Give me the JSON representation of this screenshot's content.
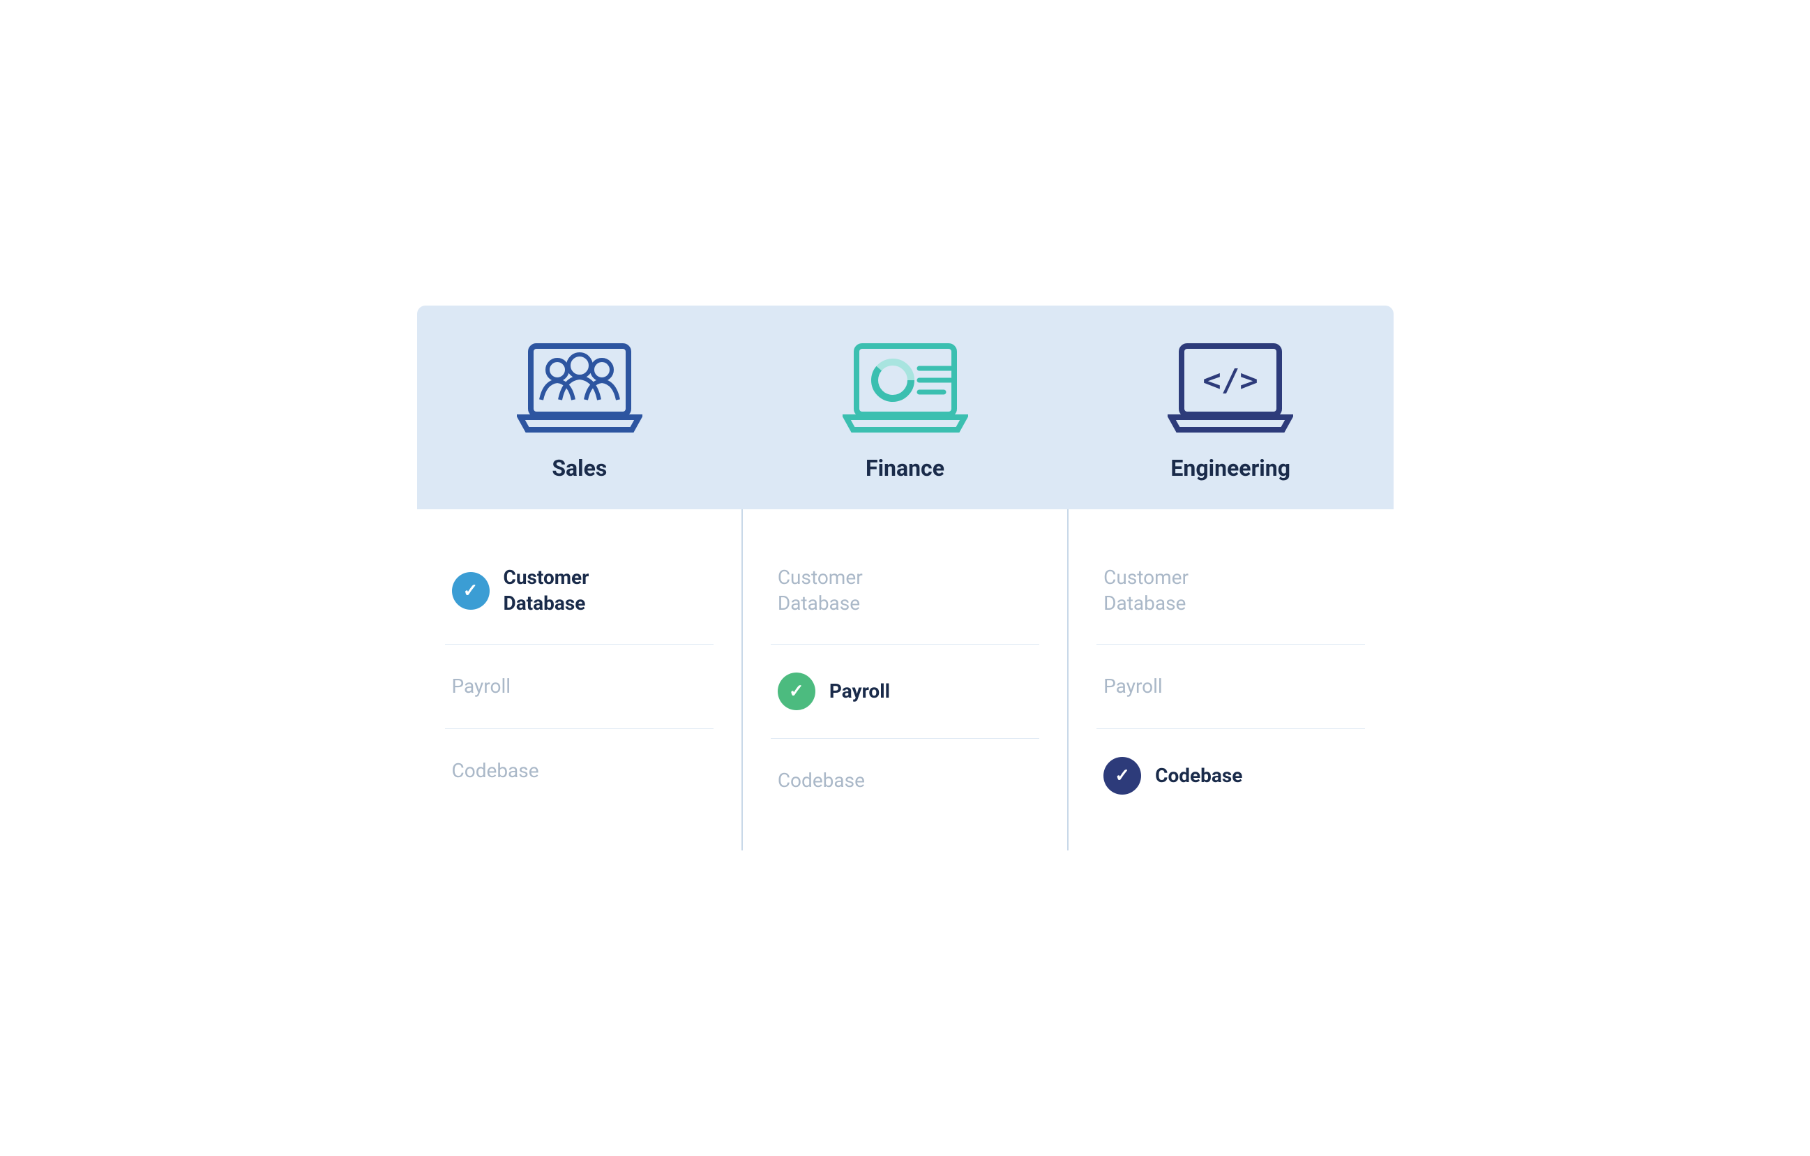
{
  "header": {
    "columns": [
      {
        "id": "sales",
        "label": "Sales",
        "icon_type": "laptop-people"
      },
      {
        "id": "finance",
        "label": "Finance",
        "icon_type": "laptop-chart"
      },
      {
        "id": "engineering",
        "label": "Engineering",
        "icon_type": "laptop-code"
      }
    ]
  },
  "rows": [
    {
      "label": "Customer Database",
      "cells": [
        {
          "checked": true,
          "check_color": "blue",
          "active": true
        },
        {
          "checked": false,
          "check_color": null,
          "active": false
        },
        {
          "checked": false,
          "check_color": null,
          "active": false
        }
      ]
    },
    {
      "label": "Payroll",
      "cells": [
        {
          "checked": false,
          "check_color": null,
          "active": false
        },
        {
          "checked": true,
          "check_color": "green",
          "active": true
        },
        {
          "checked": false,
          "check_color": null,
          "active": false
        }
      ]
    },
    {
      "label": "Codebase",
      "cells": [
        {
          "checked": false,
          "check_color": null,
          "active": false
        },
        {
          "checked": false,
          "check_color": null,
          "active": false
        },
        {
          "checked": true,
          "check_color": "dark-blue",
          "active": true
        }
      ]
    }
  ],
  "colors": {
    "header_bg": "#dce8f5",
    "divider": "#c8d8e8",
    "active_text": "#1a2b4a",
    "inactive_text": "#aab8c8",
    "check_blue": "#3b9dd4",
    "check_green": "#4cbb7f",
    "check_dark_blue": "#2d3b7a"
  }
}
